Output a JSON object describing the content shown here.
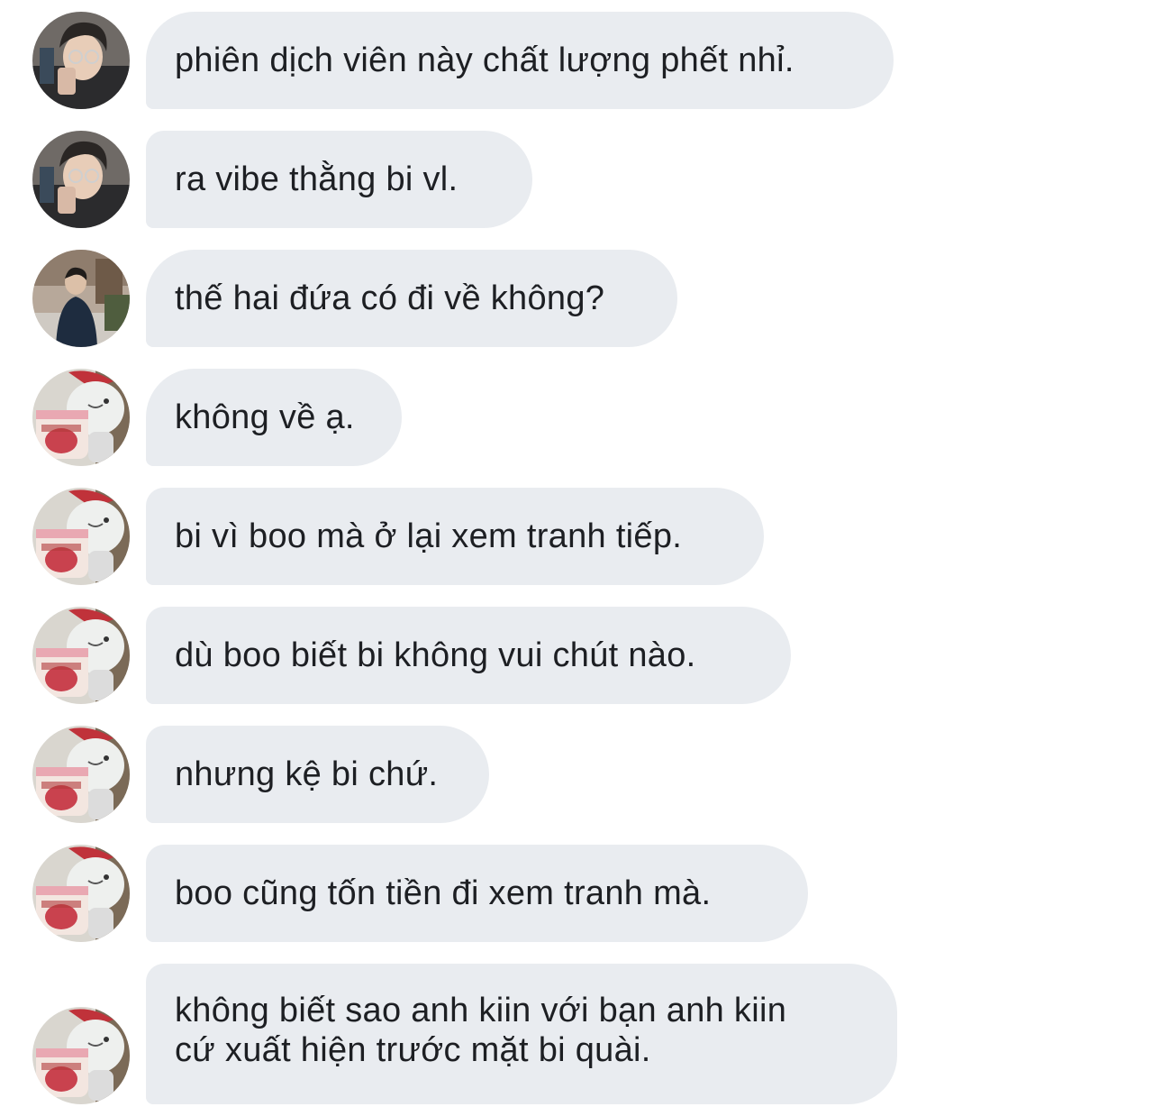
{
  "messages": [
    {
      "sender": "user-a",
      "avatar": "guy-with-glasses-avatar",
      "text": "phiên dịch viên này chất lượng phết nhỉ."
    },
    {
      "sender": "user-a",
      "avatar": "guy-with-glasses-avatar",
      "text": "ra vibe thằng bi vl."
    },
    {
      "sender": "user-b",
      "avatar": "guy-in-street-avatar",
      "text": "thế hai đứa có đi về không?"
    },
    {
      "sender": "user-c",
      "avatar": "bear-icecream-avatar",
      "text": "không về ạ."
    },
    {
      "sender": "user-c",
      "avatar": "bear-icecream-avatar",
      "text": "bi vì boo mà ở lại xem tranh tiếp."
    },
    {
      "sender": "user-c",
      "avatar": "bear-icecream-avatar",
      "text": "dù boo biết bi không vui chút nào."
    },
    {
      "sender": "user-c",
      "avatar": "bear-icecream-avatar",
      "text": "nhưng kệ bi chứ."
    },
    {
      "sender": "user-c",
      "avatar": "bear-icecream-avatar",
      "text": "boo cũng tốn tiền đi xem tranh mà."
    },
    {
      "sender": "user-c",
      "avatar": "bear-icecream-avatar",
      "text": "không biết sao anh kiin với bạn anh kiin\ncứ xuất hiện trước mặt bi quài."
    }
  ],
  "colors": {
    "bubble_bg": "#e9ecf0",
    "text": "#1d1f23",
    "background": "#ffffff"
  }
}
